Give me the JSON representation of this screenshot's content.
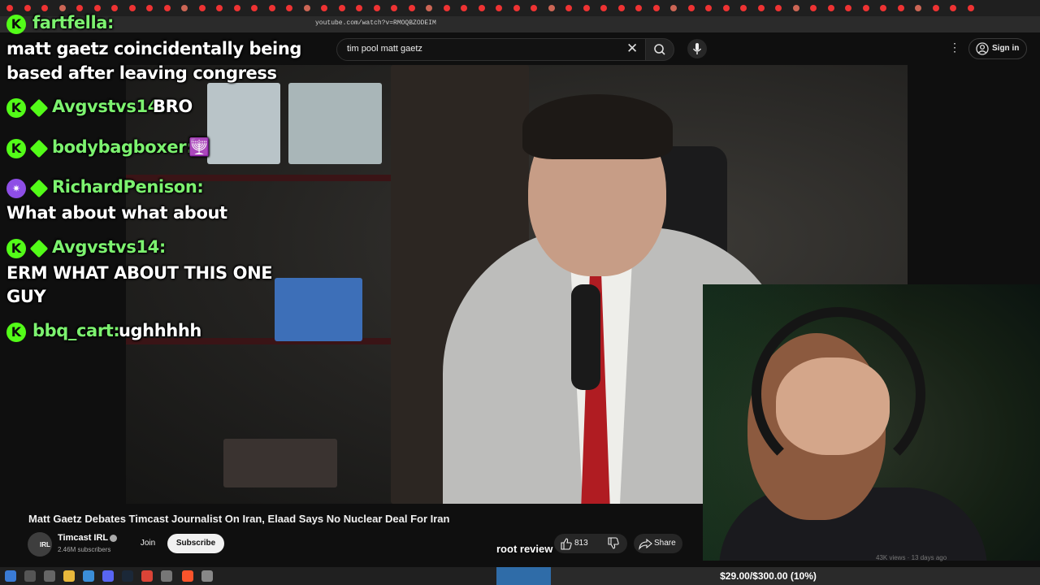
{
  "browser": {
    "url": "youtube.com/watch?v=RMOQBZODEIM"
  },
  "youtube": {
    "search_query": "tim pool matt gaetz",
    "sign_in_label": "Sign in",
    "video_title": "Matt Gaetz Debates Timcast Journalist On Iran, Elaad Says No Nuclear Deal For Iran",
    "channel": {
      "avatar_text": "IRL",
      "name": "Timcast IRL",
      "subscribers": "2.46M subscribers"
    },
    "join_label": "Join",
    "subscribe_label": "Subscribe",
    "like_count": "813",
    "share_label": "Share",
    "related_meta": "43K views · 13 days ago"
  },
  "chat": [
    {
      "badge": "K",
      "badge_style": "kick",
      "sub_badge": false,
      "user": "fartfella:",
      "message": "matt gaetz coincidentally being",
      "message2": "based after leaving congress"
    },
    {
      "badge": "K",
      "badge_style": "kick",
      "sub_badge": true,
      "user": "Avgvstvs14:",
      "message": "BRO"
    },
    {
      "badge": "K",
      "badge_style": "kick",
      "sub_badge": true,
      "user": "bodybagboxer:",
      "message": "🕎"
    },
    {
      "badge": "✷",
      "badge_style": "purple",
      "sub_badge": true,
      "user": "RichardPenison:",
      "message": "What about what about"
    },
    {
      "badge": "K",
      "badge_style": "kick",
      "sub_badge": true,
      "user": "Avgvstvs14:",
      "message": "ERM WHAT ABOUT THIS ONE",
      "message2": "GUY"
    },
    {
      "badge": "K",
      "badge_style": "kick",
      "sub_badge": false,
      "user": "bbq_cart:",
      "message": "ughhhhh"
    }
  ],
  "overlay": {
    "label": "root review",
    "goal_text": "$29.00/$300.00 (10%)",
    "goal_fraction": 0.1
  },
  "colors": {
    "kick_green": "#53fc18",
    "username_green": "#7cf26f",
    "goal_blue": "#2f6ca8"
  }
}
